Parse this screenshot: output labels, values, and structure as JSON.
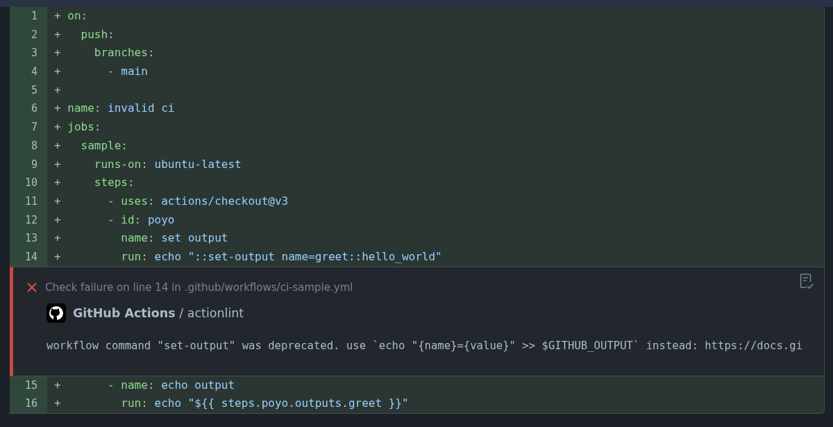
{
  "lines_before": [
    {
      "number": "1",
      "sign": "+",
      "key": "on",
      "punct": ":"
    },
    {
      "number": "2",
      "sign": "+",
      "key": "  push",
      "punct": ":"
    },
    {
      "number": "3",
      "sign": "+",
      "key": "    branches",
      "punct": ":"
    },
    {
      "number": "4",
      "sign": "+",
      "prefix": "      - ",
      "value": "main"
    },
    {
      "number": "5",
      "sign": "+"
    },
    {
      "number": "6",
      "sign": "+",
      "key": "name",
      "punct": ":",
      "value": " invalid ci"
    },
    {
      "number": "7",
      "sign": "+",
      "key": "jobs",
      "punct": ":"
    },
    {
      "number": "8",
      "sign": "+",
      "key": "  sample",
      "punct": ":"
    },
    {
      "number": "9",
      "sign": "+",
      "key": "    runs-on",
      "punct": ":",
      "value": " ubuntu-latest"
    },
    {
      "number": "10",
      "sign": "+",
      "key": "    steps",
      "punct": ":"
    },
    {
      "number": "11",
      "sign": "+",
      "prefix": "      - ",
      "key": "uses",
      "punct": ":",
      "value": " actions/checkout@v3"
    },
    {
      "number": "12",
      "sign": "+",
      "prefix": "      - ",
      "key": "id",
      "punct": ":",
      "value": " poyo"
    },
    {
      "number": "13",
      "sign": "+",
      "key": "        name",
      "punct": ":",
      "value": " set output"
    },
    {
      "number": "14",
      "sign": "+",
      "key": "        run",
      "punct": ":",
      "value": " echo \"::set-output name=greet::hello_world\""
    }
  ],
  "annotation": {
    "title": "Check failure on line 14 in .github/workflows/ci-sample.yml",
    "app": "GitHub Actions",
    "separator": " / ",
    "check": "actionlint",
    "message": "workflow command \"set-output\" was deprecated. use `echo \"{name}={value}\" >> $GITHUB_OUTPUT` instead: https://docs.gi"
  },
  "lines_after": [
    {
      "number": "15",
      "sign": "+",
      "prefix": "      - ",
      "key": "name",
      "punct": ":",
      "value": " echo output"
    },
    {
      "number": "16",
      "sign": "+",
      "key": "        run",
      "punct": ":",
      "value": " echo \"${{ steps.poyo.outputs.greet }}\""
    }
  ]
}
